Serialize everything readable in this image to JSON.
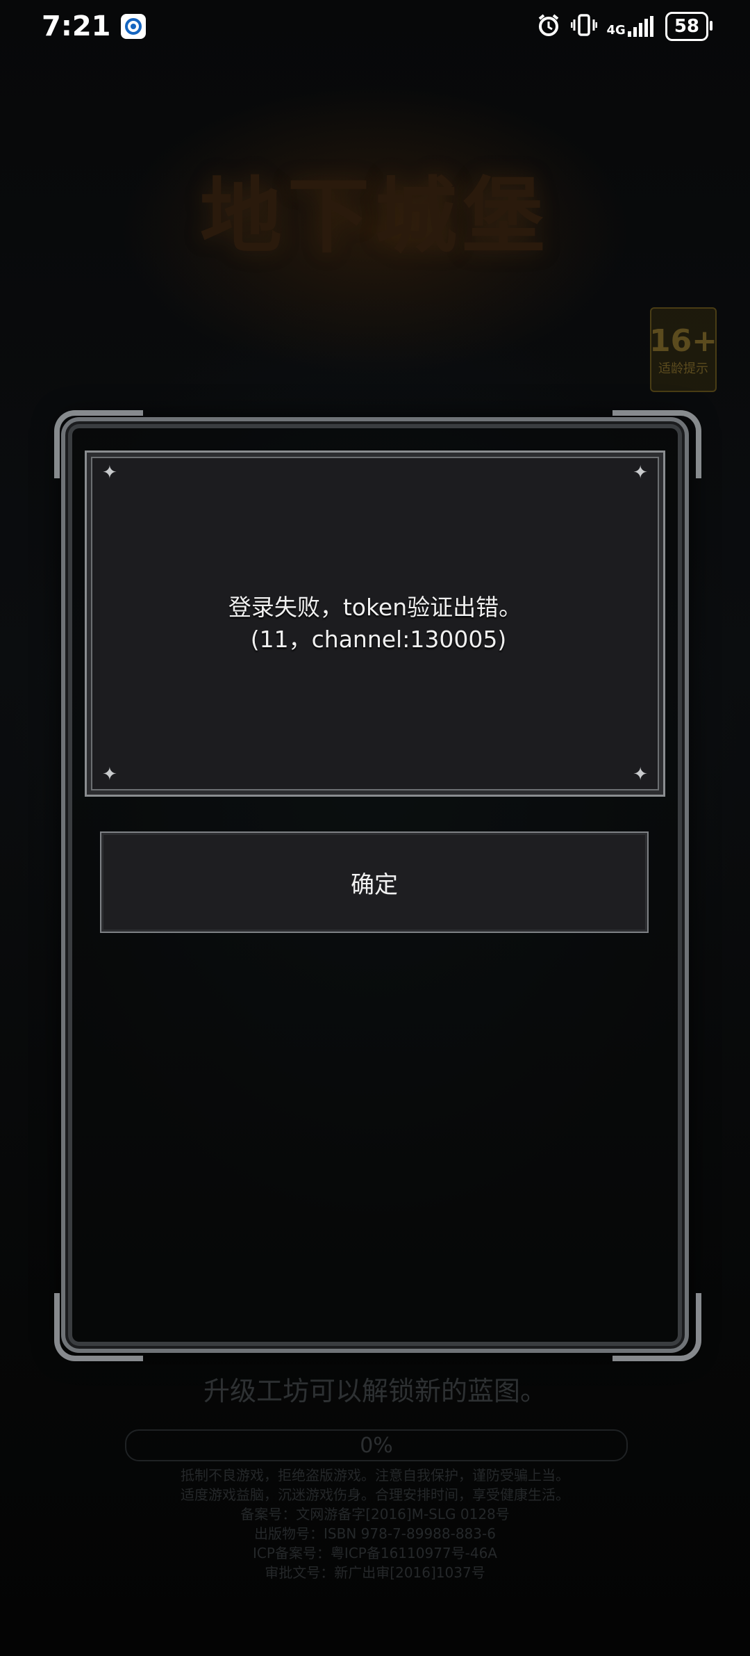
{
  "status_bar": {
    "time": "7:21",
    "network": "4G",
    "battery": "58"
  },
  "background": {
    "logo": "地下城堡",
    "age_rating": {
      "number": "16+",
      "caption": "适龄提示"
    },
    "tip": "升级工坊可以解锁新的蓝图。",
    "progress": "0%",
    "notice_lines": [
      "抵制不良游戏，拒绝盗版游戏。注意自我保护，谨防受骗上当。",
      "适度游戏益脑，沉迷游戏伤身。合理安排时间，享受健康生活。",
      "备案号：文网游备字[2016]M-SLG 0128号",
      "出版物号：ISBN 978-7-89988-883-6",
      "ICP备案号：粤ICP备16110977号-46A",
      "审批文号：新广出审[2016]1037号"
    ]
  },
  "dialog": {
    "message_line1": "登录失败，token验证出错。",
    "message_line2": "(11，channel:130005)",
    "confirm_label": "确定"
  }
}
